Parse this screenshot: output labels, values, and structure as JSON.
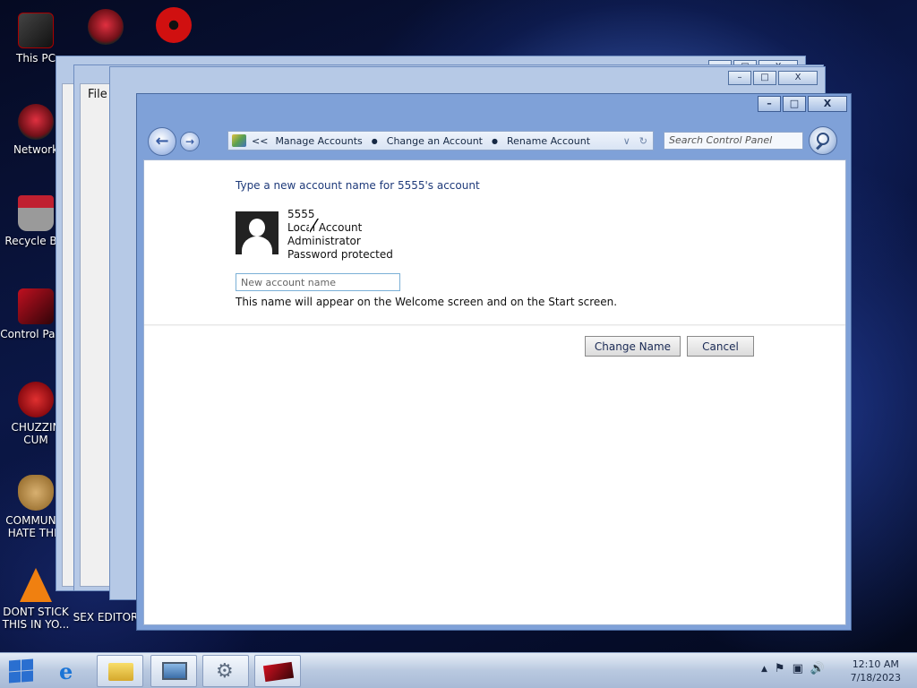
{
  "desktop": {
    "icons": [
      {
        "label": "This PC"
      },
      {
        "label": "Network"
      },
      {
        "label": "Recycle Bin"
      },
      {
        "label": "Control Panel"
      },
      {
        "label": "CHUZZIN CUM"
      },
      {
        "label": "COMMUNIS HATE THIS"
      },
      {
        "label": "DONT STICK THIS IN YO..."
      },
      {
        "label": "SEX EDITOR"
      }
    ]
  },
  "background_windows": {
    "menu_file": "File"
  },
  "window": {
    "caption": {
      "minimize": "–",
      "maximize": "□",
      "close": "X"
    },
    "nav": {
      "back_icon": "arrow-left-icon",
      "forward_icon": "arrow-right-icon"
    },
    "address": {
      "overflow": "<<",
      "crumbs": [
        "Manage Accounts",
        "Change an Account",
        "Rename Account"
      ]
    },
    "search": {
      "placeholder": "Search Control Panel"
    },
    "content": {
      "prompt": "Type a new account name for 5555's account",
      "account": {
        "name": "5555",
        "type": "Local Account",
        "role": "Administrator",
        "protection": "Password protected"
      },
      "new_name_placeholder": "New account name",
      "hint": "This name will appear on the Welcome screen and on the Start screen.",
      "change_button": "Change Name",
      "cancel_button": "Cancel"
    }
  },
  "taskbar": {
    "clock_time": "12:10 AM",
    "clock_date": "7/18/2023",
    "tray_icons": [
      "chevron-up-icon",
      "flag-icon",
      "network-icon",
      "volume-icon"
    ]
  },
  "colors": {
    "link_text": "#1e3a7a",
    "window_frame": "#7fa1d8",
    "taskbar": "#b9c9e0"
  }
}
